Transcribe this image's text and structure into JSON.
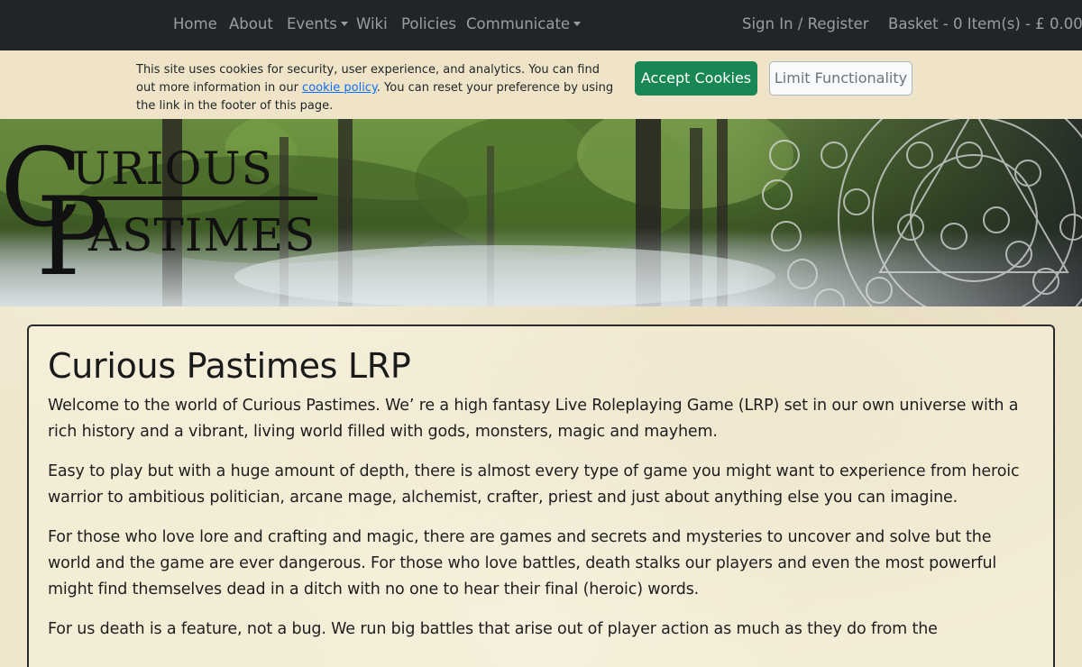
{
  "nav": {
    "home": "Home",
    "about": "About",
    "events": "Events",
    "wiki": "Wiki",
    "policies": "Policies",
    "communicate": "Communicate",
    "sign_in": "Sign In / Register",
    "basket": "Basket - 0 Item(s) - £ 0.00"
  },
  "cookie": {
    "text_before": "This site uses cookies for security, user experience, and analytics. You can find out more information in our ",
    "link": "cookie policy",
    "text_after": ". You can reset your preference by using the link in the footer of this page.",
    "accept_label": "Accept Cookies",
    "limit_label": "Limit Functionality"
  },
  "banner": {
    "logo_line1": "URIOUS",
    "logo_line2": "ASTIMES",
    "logo_initial1": "C",
    "logo_initial2": "P"
  },
  "main": {
    "title": "Curious Pastimes LRP",
    "paragraphs": [
      "Welcome to the world of Curious Pastimes. We’ re a high fantasy Live Roleplaying Game (LRP) set in our own universe with a rich history and a vibrant, living world filled with gods, monsters, magic and mayhem.",
      "Easy to play but with a huge amount of depth, there is almost every type of game you might want to experience from heroic warrior to ambitious politician, arcane mage, alchemist, crafter, priest and just about anything else you can imagine.",
      "For those who love lore and crafting and magic, there are games and secrets and mysteries to uncover and solve but the world and the game are ever dangerous. For those who love battles, death stalks our players and even the most powerful might find themselves dead in a ditch with no one to hear their final (heroic) words.",
      "For us death is a feature, not a bug. We run big battles that arise out of player action as much as they do from the"
    ]
  },
  "colors": {
    "navbar": "#212529",
    "accept": "#198754",
    "link": "#0d6efd"
  }
}
